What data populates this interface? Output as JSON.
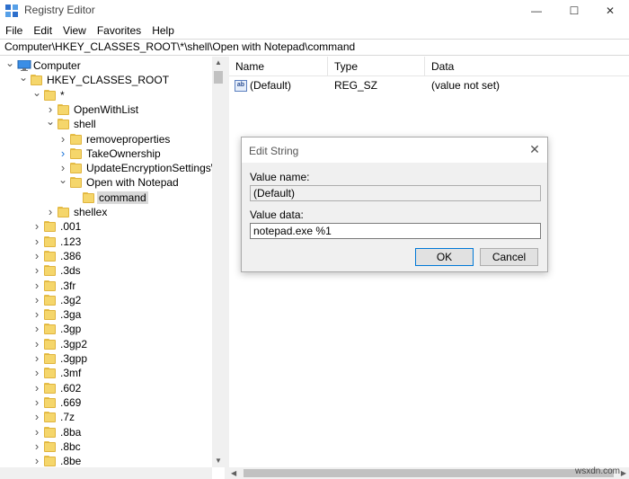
{
  "window": {
    "title": "Registry Editor",
    "minimize_glyph": "—",
    "maximize_glyph": "☐",
    "close_glyph": "✕"
  },
  "menu": [
    "File",
    "Edit",
    "View",
    "Favorites",
    "Help"
  ],
  "address": "Computer\\HKEY_CLASSES_ROOT\\*\\shell\\Open with Notepad\\command",
  "tree": {
    "items": [
      {
        "label": "Computer",
        "level": 0,
        "expander": "expanded",
        "icon": "computer-icon"
      },
      {
        "label": "HKEY_CLASSES_ROOT",
        "level": 1,
        "expander": "expanded",
        "icon": "folder-icon"
      },
      {
        "label": "*",
        "level": 2,
        "expander": "expanded",
        "icon": "folder-icon"
      },
      {
        "label": "OpenWithList",
        "level": 3,
        "expander": "collapsed",
        "icon": "folder-icon"
      },
      {
        "label": "shell",
        "level": 3,
        "expander": "expanded",
        "icon": "folder-icon"
      },
      {
        "label": "removeproperties",
        "level": 4,
        "expander": "collapsed",
        "icon": "folder-icon"
      },
      {
        "label": "TakeOwnership",
        "level": 4,
        "expander": "collapsed-blue",
        "icon": "folder-icon"
      },
      {
        "label": "UpdateEncryptionSettingsWo",
        "level": 4,
        "expander": "collapsed",
        "icon": "folder-icon"
      },
      {
        "label": "Open with Notepad",
        "level": 4,
        "expander": "expanded",
        "icon": "folder-icon"
      },
      {
        "label": "command",
        "level": 5,
        "expander": "none",
        "icon": "folder-icon",
        "selected": true
      },
      {
        "label": "shellex",
        "level": 3,
        "expander": "collapsed",
        "icon": "folder-icon"
      },
      {
        "label": ".001",
        "level": 2,
        "expander": "collapsed",
        "icon": "folder-icon"
      },
      {
        "label": ".123",
        "level": 2,
        "expander": "collapsed",
        "icon": "folder-icon"
      },
      {
        "label": ".386",
        "level": 2,
        "expander": "collapsed",
        "icon": "folder-icon"
      },
      {
        "label": ".3ds",
        "level": 2,
        "expander": "collapsed",
        "icon": "folder-icon"
      },
      {
        "label": ".3fr",
        "level": 2,
        "expander": "collapsed",
        "icon": "folder-icon"
      },
      {
        "label": ".3g2",
        "level": 2,
        "expander": "collapsed",
        "icon": "folder-icon"
      },
      {
        "label": ".3ga",
        "level": 2,
        "expander": "collapsed",
        "icon": "folder-icon"
      },
      {
        "label": ".3gp",
        "level": 2,
        "expander": "collapsed",
        "icon": "folder-icon"
      },
      {
        "label": ".3gp2",
        "level": 2,
        "expander": "collapsed",
        "icon": "folder-icon"
      },
      {
        "label": ".3gpp",
        "level": 2,
        "expander": "collapsed",
        "icon": "folder-icon"
      },
      {
        "label": ".3mf",
        "level": 2,
        "expander": "collapsed",
        "icon": "folder-icon"
      },
      {
        "label": ".602",
        "level": 2,
        "expander": "collapsed",
        "icon": "folder-icon"
      },
      {
        "label": ".669",
        "level": 2,
        "expander": "collapsed",
        "icon": "folder-icon"
      },
      {
        "label": ".7z",
        "level": 2,
        "expander": "collapsed",
        "icon": "folder-icon"
      },
      {
        "label": ".8ba",
        "level": 2,
        "expander": "collapsed",
        "icon": "folder-icon"
      },
      {
        "label": ".8bc",
        "level": 2,
        "expander": "collapsed",
        "icon": "folder-icon"
      },
      {
        "label": ".8be",
        "level": 2,
        "expander": "collapsed",
        "icon": "folder-icon"
      }
    ]
  },
  "values": {
    "columns": {
      "name": "Name",
      "type": "Type",
      "data": "Data"
    },
    "rows": [
      {
        "name": "(Default)",
        "type": "REG_SZ",
        "data": "(value not set)",
        "icon": "string-value-icon",
        "icon_text": "ab"
      }
    ]
  },
  "dialog": {
    "title": "Edit String",
    "value_name_label": "Value name:",
    "value_name": "(Default)",
    "value_data_label": "Value data:",
    "value_data": "notepad.exe %1",
    "ok_label": "OK",
    "cancel_label": "Cancel"
  },
  "watermark": "wsxdn.com",
  "colors": {
    "folder": "#f5d66b",
    "accent": "#0078d7",
    "selection": "#d9d9d9"
  }
}
